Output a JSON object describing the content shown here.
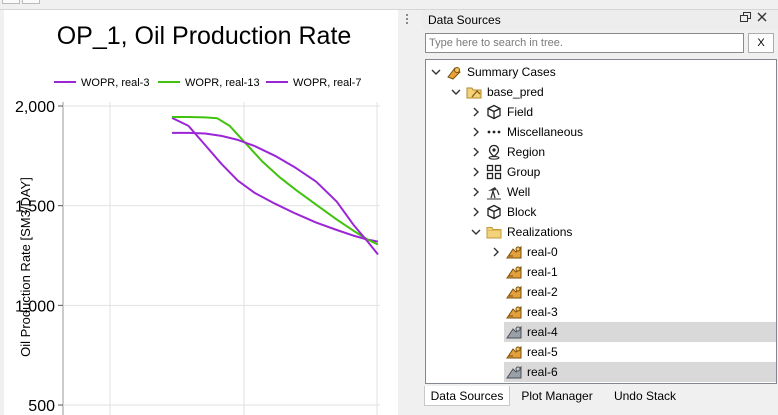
{
  "plot": {
    "title": "OP_1, Oil Production Rate",
    "ylabel": "Oil Production Rate [SM3/DAY]"
  },
  "chart_data": {
    "type": "line",
    "title": "OP_1, Oil Production Rate",
    "xlabel": "",
    "ylabel": "Oil Production Rate [SM3/DAY]",
    "ylim": [
      450,
      2020
    ],
    "yticks": [
      500,
      1000,
      1500,
      2000
    ],
    "ytick_labels": [
      "500",
      "1,000",
      "1,500",
      "2,000"
    ],
    "xlim": [
      0,
      100
    ],
    "grid": true,
    "legend_placement": "top",
    "series": [
      {
        "name": "WOPR, real-3",
        "color": "#9b26d6",
        "x": [
          0,
          8,
          16,
          24,
          32,
          40,
          50,
          60,
          70,
          80,
          88,
          95,
          100
        ],
        "y": [
          1940,
          1900,
          1805,
          1710,
          1625,
          1565,
          1510,
          1460,
          1415,
          1378,
          1350,
          1330,
          1320
        ]
      },
      {
        "name": "WOPR, real-13",
        "color": "#41c20d",
        "x": [
          0,
          8,
          16,
          22,
          28,
          36,
          44,
          52,
          60,
          70,
          80,
          88,
          95,
          100
        ],
        "y": [
          1945,
          1945,
          1943,
          1938,
          1900,
          1810,
          1720,
          1645,
          1580,
          1505,
          1430,
          1375,
          1330,
          1305
        ]
      },
      {
        "name": "WOPR, real-7",
        "color": "#9b26d6",
        "x": [
          0,
          8,
          16,
          24,
          32,
          40,
          50,
          60,
          70,
          80,
          88,
          95,
          100
        ],
        "y": [
          1865,
          1865,
          1862,
          1850,
          1830,
          1800,
          1750,
          1690,
          1620,
          1520,
          1405,
          1320,
          1255
        ]
      }
    ]
  },
  "dock": {
    "title": "Data Sources",
    "float_icon": "float-icon",
    "close_icon": "close-icon",
    "search_placeholder": "Type here to search in tree.",
    "clear_label": "X"
  },
  "tree": [
    {
      "label": "Summary Cases",
      "icon": "summary-cases-icon",
      "toggle": "expanded"
    },
    {
      "label": "base_pred",
      "icon": "case-folder-icon",
      "toggle": "expanded"
    },
    {
      "label": "Field",
      "icon": "field-cube-icon",
      "toggle": "collapsed"
    },
    {
      "label": "Miscellaneous",
      "icon": "dots-icon",
      "toggle": "collapsed"
    },
    {
      "label": "Region",
      "icon": "region-pin-icon",
      "toggle": "collapsed"
    },
    {
      "label": "Group",
      "icon": "group-grid-icon",
      "toggle": "collapsed"
    },
    {
      "label": "Well",
      "icon": "well-icon",
      "toggle": "collapsed"
    },
    {
      "label": "Block",
      "icon": "block-cube-icon",
      "toggle": "collapsed"
    },
    {
      "label": "Realizations",
      "icon": "folder-icon",
      "toggle": "expanded"
    },
    {
      "label": "real-0",
      "icon": "realization-icon",
      "toggle": "collapsed"
    },
    {
      "label": "real-1",
      "icon": "realization-icon",
      "toggle": "none"
    },
    {
      "label": "real-2",
      "icon": "realization-icon",
      "toggle": "none"
    },
    {
      "label": "real-3",
      "icon": "realization-icon",
      "toggle": "none"
    },
    {
      "label": "real-4",
      "icon": "realization-selected-icon",
      "toggle": "none",
      "selected": true
    },
    {
      "label": "real-5",
      "icon": "realization-icon",
      "toggle": "none"
    },
    {
      "label": "real-6",
      "icon": "realization-selected-icon",
      "toggle": "none",
      "selected": true
    }
  ],
  "tabs": [
    {
      "label": "Data Sources",
      "active": true
    },
    {
      "label": "Plot Manager",
      "active": false
    },
    {
      "label": "Undo Stack",
      "active": false
    }
  ],
  "colors": {
    "purple_series": "#9b26d6",
    "green_series": "#41c20d",
    "selection": "#d9d9d9"
  }
}
